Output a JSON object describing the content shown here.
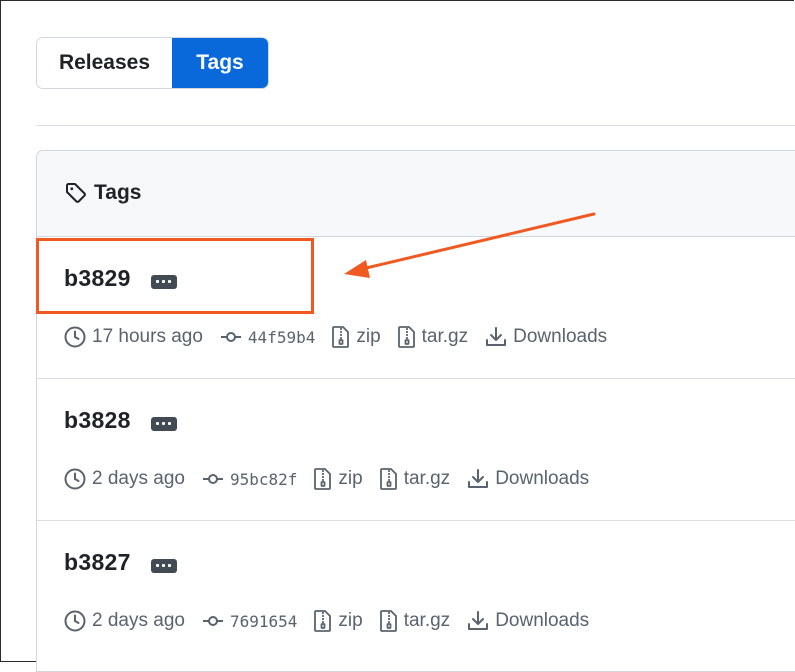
{
  "nav": {
    "releases_label": "Releases",
    "tags_label": "Tags",
    "active": "Tags"
  },
  "tags_box": {
    "title": "Tags",
    "items": [
      {
        "name": "b3829",
        "time": "17 hours ago",
        "commit": "44f59b4",
        "zip_label": "zip",
        "targz_label": "tar.gz",
        "downloads_label": "Downloads"
      },
      {
        "name": "b3828",
        "time": "2 days ago",
        "commit": "95bc82f",
        "zip_label": "zip",
        "targz_label": "tar.gz",
        "downloads_label": "Downloads"
      },
      {
        "name": "b3827",
        "time": "2 days ago",
        "commit": "7691654",
        "zip_label": "zip",
        "targz_label": "tar.gz",
        "downloads_label": "Downloads"
      }
    ]
  },
  "icons": [
    "tag-icon",
    "more-icon",
    "clock-icon",
    "commit-icon",
    "file-zip-icon",
    "download-icon"
  ],
  "colors": {
    "accent": "#0969da",
    "annotation": "#f05a22",
    "muted_text": "#59636e"
  }
}
